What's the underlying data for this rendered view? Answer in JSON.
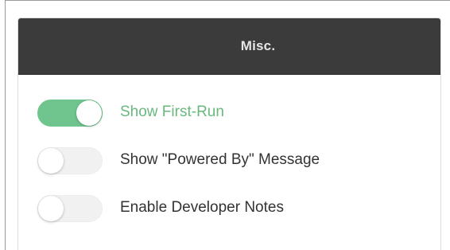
{
  "panel": {
    "title": "Misc."
  },
  "settings": [
    {
      "label": "Show First-Run",
      "enabled": true
    },
    {
      "label": "Show \"Powered By\" Message",
      "enabled": false
    },
    {
      "label": "Enable Developer Notes",
      "enabled": false
    }
  ],
  "colors": {
    "header_bg": "#3b3b3b",
    "header_text": "#e6e6e6",
    "toggle_on": "#6fc58d",
    "toggle_off": "#f1f1f1",
    "active_label": "#69b97f",
    "label": "#333333"
  }
}
